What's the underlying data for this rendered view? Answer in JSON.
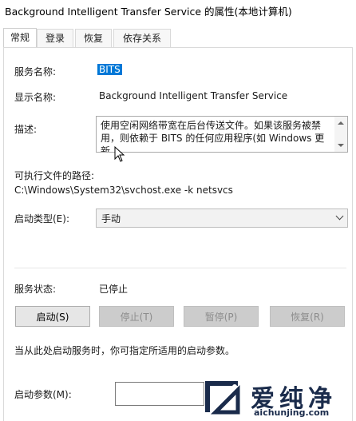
{
  "window": {
    "title": "Background Intelligent Transfer Service 的属性(本地计算机)"
  },
  "tabs": [
    {
      "label": "常规",
      "active": true
    },
    {
      "label": "登录",
      "active": false
    },
    {
      "label": "恢复",
      "active": false
    },
    {
      "label": "依存关系",
      "active": false
    }
  ],
  "general": {
    "service_name_label": "服务名称:",
    "service_name_value": "BITS",
    "display_name_label": "显示名称:",
    "display_name_value": "Background Intelligent Transfer Service",
    "description_label": "描述:",
    "description_value": "使用空闲网络带宽在后台传送文件。如果该服务被禁用，则依赖于 BITS 的任何应用程序(如 Windows 更新",
    "exec_path_label": "可执行文件的路径:",
    "exec_path_value": "C:\\Windows\\System32\\svchost.exe -k netsvcs",
    "startup_type_label": "启动类型(E):",
    "startup_type_value": "手动",
    "status_label": "服务状态:",
    "status_value": "已停止",
    "buttons": {
      "start": "启动(S)",
      "stop": "停止(T)",
      "pause": "暂停(P)",
      "resume": "恢复(R)"
    },
    "hint_text": "当从此处启动服务时，你可指定所适用的启动参数。",
    "start_params_label": "启动参数(M):",
    "start_params_value": ""
  },
  "watermark": {
    "chinese": "爱纯净",
    "url": "aichunjing.com"
  },
  "colors": {
    "selection": "#0078d7",
    "disabled_button": "#cccccc"
  }
}
